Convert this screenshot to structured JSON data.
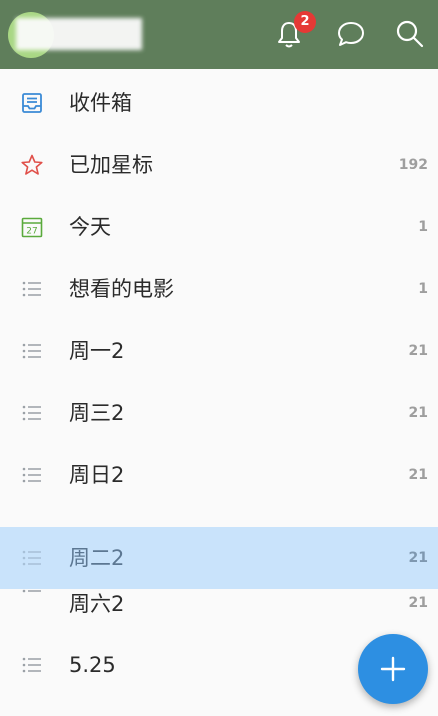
{
  "header": {
    "notification_badge": "2",
    "icons": [
      "bell-icon",
      "chat-bubble-icon",
      "search-icon"
    ],
    "accent_color": "#5f7e5b"
  },
  "lists": [
    {
      "label": "收件箱",
      "count": "",
      "icon": "inbox-icon"
    },
    {
      "label": "已加星标",
      "count": "192",
      "icon": "star-icon"
    },
    {
      "label": "今天",
      "count": "1",
      "icon": "calendar-today-icon",
      "calendar_day": "27"
    },
    {
      "label": "想看的电影",
      "count": "1",
      "icon": "list-icon"
    },
    {
      "label": "周一2",
      "count": "21",
      "icon": "list-icon"
    },
    {
      "label": "周三2",
      "count": "21",
      "icon": "list-icon"
    },
    {
      "label": "周日2",
      "count": "21",
      "icon": "list-icon"
    },
    {
      "label": "周二2",
      "count": "21",
      "icon": "list-icon",
      "selected": true
    },
    {
      "label": "周六2",
      "count": "21",
      "icon": "list-icon"
    },
    {
      "label": "5.25",
      "count": "",
      "icon": "list-icon"
    }
  ],
  "fab": {
    "icon": "plus-icon",
    "color": "#2d8fe2"
  }
}
